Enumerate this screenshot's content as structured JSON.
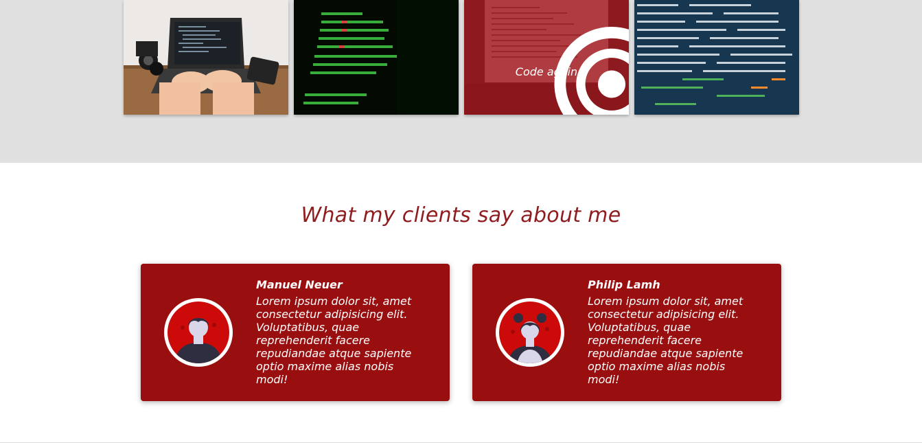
{
  "gallery": {
    "tiles": [
      {
        "name": "laptop-desk-photo"
      },
      {
        "name": "green-code-photo"
      },
      {
        "name": "red-code-photo",
        "caption": "Code again",
        "icon": "target-icon"
      },
      {
        "name": "blue-code-photo"
      }
    ]
  },
  "testimonials": {
    "title": "What my clients say about me",
    "clients": [
      {
        "name": "Manuel Neuer",
        "quote": "Lorem ipsum dolor sit, amet consectetur adipisicing elit. Voluptatibus, quae reprehenderit facere repudiandae atque sapiente optio maxime alias nobis modi!",
        "avatar": "male-avatar-icon"
      },
      {
        "name": "Philip Lamh",
        "quote": "Lorem ipsum dolor sit, amet consectetur adipisicing elit. Voluptatibus, quae reprehenderit facere repudiandae atque sapiente optio maxime alias nobis modi!",
        "avatar": "female-avatar-icon"
      }
    ]
  },
  "colors": {
    "accent": "#990f10",
    "title": "#8f1d1f",
    "gallery_bg": "#e0e0e0"
  }
}
